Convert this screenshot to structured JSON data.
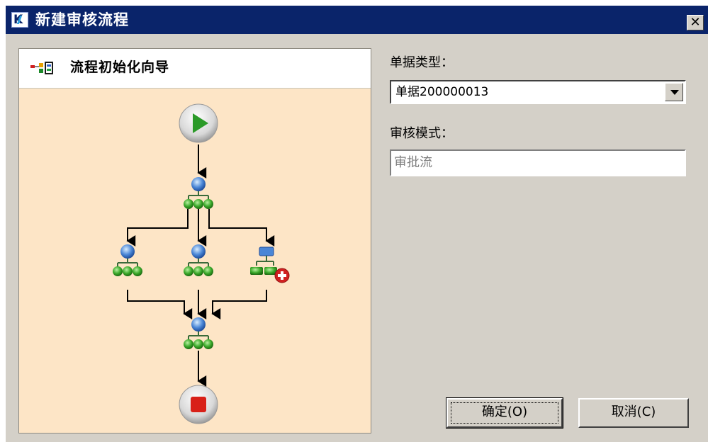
{
  "window": {
    "title": "新建审核流程",
    "app_icon": "k3-logo-icon",
    "close_label": "✕"
  },
  "wizard": {
    "title": "流程初始化向导",
    "icon": "flow-chart-icon"
  },
  "form": {
    "doc_type_label": "单据类型：",
    "doc_type_value": "单据200000013",
    "audit_mode_label": "审核模式：",
    "audit_mode_value": "审批流"
  },
  "buttons": {
    "ok": "确定(O)",
    "cancel": "取消(C)"
  },
  "colors": {
    "titlebar": "#0a246a",
    "panel_bg": "#fde5c6",
    "dialog_bg": "#d4d0c8"
  }
}
